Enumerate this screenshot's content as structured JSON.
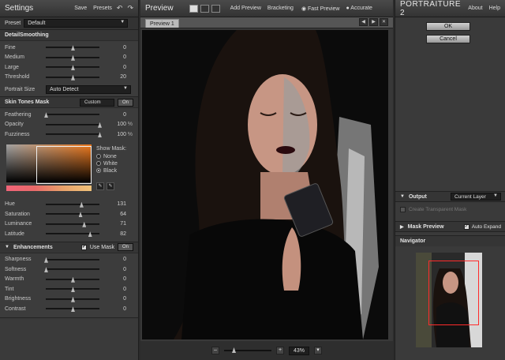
{
  "left": {
    "title": "Settings",
    "save": "Save",
    "presets": "Presets",
    "preset_label": "Preset",
    "preset_value": "Default",
    "detail": {
      "heading": "DetailSmoothing",
      "rows": [
        {
          "label": "Fine",
          "value": "0",
          "pos": 0.5
        },
        {
          "label": "Medium",
          "value": "0",
          "pos": 0.5
        },
        {
          "label": "Large",
          "value": "0",
          "pos": 0.5
        },
        {
          "label": "Threshold",
          "value": "20",
          "pos": 0.5
        }
      ],
      "portrait_label": "Portrait Size",
      "portrait_value": "Auto Detect"
    },
    "skin": {
      "heading": "Skin Tones Mask",
      "mode": "Custom",
      "on": "On",
      "rows": [
        {
          "label": "Feathering",
          "value": "0",
          "pct": "",
          "pos": 0.0
        },
        {
          "label": "Opacity",
          "value": "100",
          "pct": "%",
          "pos": 1.0
        },
        {
          "label": "Fuzziness",
          "value": "100",
          "pct": "%",
          "pos": 1.0
        }
      ],
      "show_mask": "Show Mask:",
      "mask_opts": [
        "None",
        "White",
        "Black"
      ],
      "hsl": [
        {
          "label": "Hue",
          "value": "131",
          "pos": 0.66
        },
        {
          "label": "Saturation",
          "value": "64",
          "pos": 0.64
        },
        {
          "label": "Luminance",
          "value": "71",
          "pos": 0.71
        },
        {
          "label": "Latitude",
          "value": "82",
          "pos": 0.82
        }
      ]
    },
    "enh": {
      "heading": "Enhancements",
      "use_mask": "Use Mask",
      "on": "On",
      "rows": [
        {
          "label": "Sharpness",
          "value": "0",
          "pos": 0.0
        },
        {
          "label": "Softness",
          "value": "0",
          "pos": 0.0
        },
        {
          "label": "Warmth",
          "value": "0",
          "pos": 0.5
        },
        {
          "label": "Tint",
          "value": "0",
          "pos": 0.5
        },
        {
          "label": "Brightness",
          "value": "0",
          "pos": 0.5
        },
        {
          "label": "Contrast",
          "value": "0",
          "pos": 0.5
        }
      ]
    }
  },
  "center": {
    "title": "Preview",
    "add_preview": "Add Preview",
    "bracketing": "Bracketing",
    "fast": "Fast Preview",
    "accurate": "Accurate",
    "tab": "Preview 1",
    "zoom": "43%"
  },
  "right": {
    "brand": "PORTRAITURE 2",
    "about": "About",
    "help": "Help",
    "ok": "OK",
    "cancel": "Cancel",
    "output": "Output",
    "output_value": "Current Layer",
    "create_transparent": "Create Transparent Mask",
    "mask_preview": "Mask Preview",
    "auto_expand": "Auto Expand",
    "navigator": "Navigator"
  }
}
